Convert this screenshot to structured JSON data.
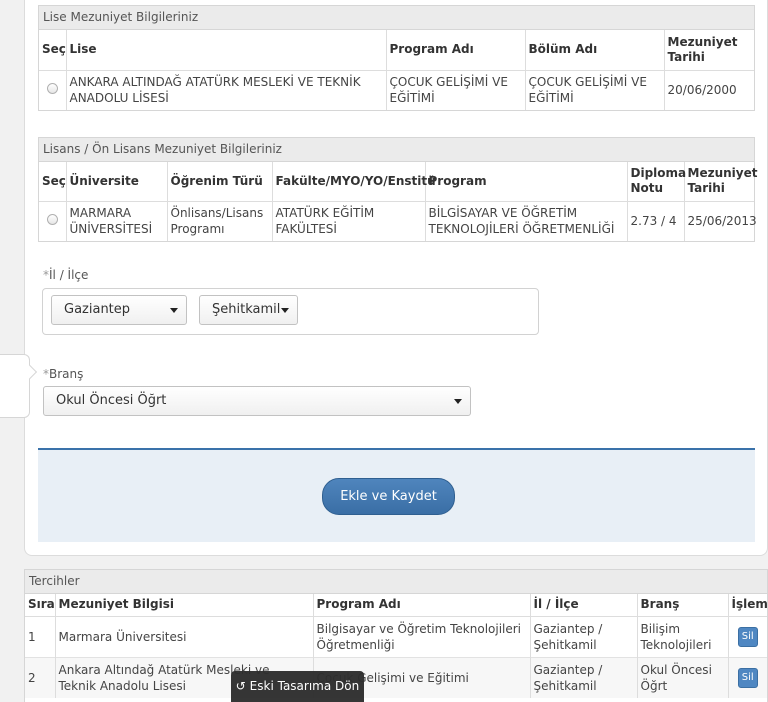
{
  "lise_section": {
    "title": "Lise Mezuniyet Bilgileriniz",
    "headers": [
      "Seç",
      "Lise",
      "Program Adı",
      "Bölüm Adı",
      "Mezuniyet Tarihi"
    ],
    "rows": [
      {
        "school": "ANKARA ALTINDAĞ ATATÜRK MESLEKİ VE TEKNİK ANADOLU LİSESİ",
        "program": "ÇOCUK GELİŞİMİ VE EĞİTİMİ",
        "department": "ÇOCUK GELİŞİMİ VE EĞİTİMİ",
        "date": "20/06/2000"
      }
    ]
  },
  "lisans_section": {
    "title": "Lisans / Ön Lisans Mezuniyet Bilgileriniz",
    "headers": [
      "Seç",
      "Üniversite",
      "Öğrenim Türü",
      "Fakülte/MYO/YO/Enstitü",
      "Program",
      "Diploma Notu",
      "Mezuniyet Tarihi"
    ],
    "rows": [
      {
        "university": "MARMARA ÜNİVERSİTESİ",
        "type": "Önlisans/Lisans Programı",
        "faculty": "ATATÜRK EĞİTİM FAKÜLTESİ",
        "program": "BİLGİSAYAR VE ÖĞRETİM TEKNOLOJİLERİ ÖĞRETMENLİĞİ",
        "grade": "2.73 / 4",
        "date": "25/06/2013"
      }
    ]
  },
  "location": {
    "required_mark": "*",
    "label": "İl / İlçe",
    "il_value": "Gaziantep",
    "ilce_value": "Şehitkamil"
  },
  "brans": {
    "required_mark": "*",
    "label": "Branş",
    "value": "Okul Öncesi Öğrt"
  },
  "save_button": "Ekle ve Kaydet",
  "tercihler": {
    "title": "Tercihler",
    "headers": [
      "Sıra",
      "Mezuniyet Bilgisi",
      "Program Adı",
      "İl / İlçe",
      "Branş",
      "İşlem"
    ],
    "rows": [
      {
        "sira": "1",
        "mezuniyet": "Marmara Üniversitesi",
        "program": "Bilgisayar ve Öğretim Teknolojileri Öğretmenliği",
        "il_ilce": "Gaziantep / Şehitkamil",
        "brans": "Bilişim Teknolojileri",
        "action": "Sil"
      },
      {
        "sira": "2",
        "mezuniyet": "Ankara Altındağ Atatürk Mesleki ve Teknik Anadolu Lisesi",
        "program": "Çocuk Gelişimi ve Eğitimi",
        "il_ilce": "Gaziantep / Şehitkamil",
        "brans": "Okul Öncesi Öğrt",
        "action": "Sil"
      }
    ]
  },
  "old_design_button": "Eski Tasarıma Dön"
}
